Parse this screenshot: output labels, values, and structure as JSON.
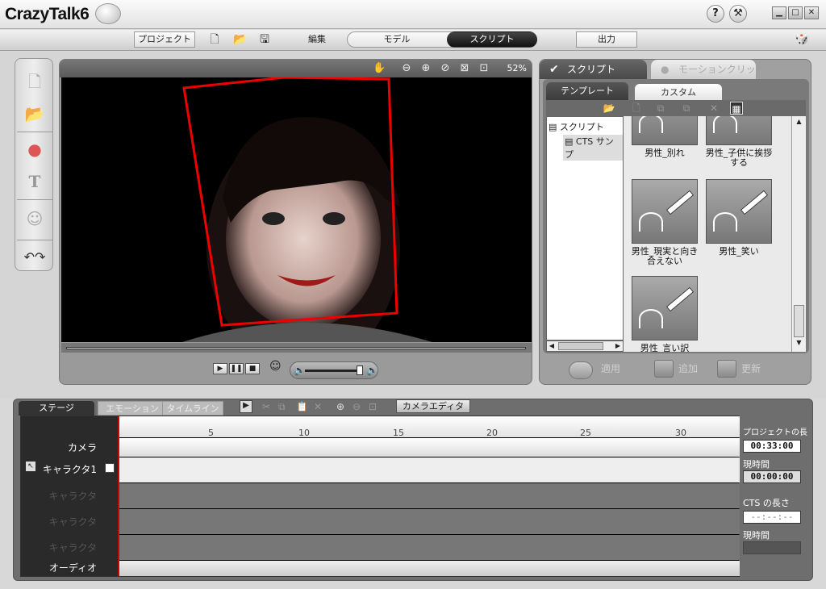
{
  "app": {
    "title": "CrazyTalk6"
  },
  "menu": {
    "project": "プロジェクト",
    "edit": "編集",
    "model": "モデル",
    "script": "スクリプト",
    "output": "出力"
  },
  "viewer": {
    "zoom": "52%"
  },
  "right_panel": {
    "tab_script": "スクリプト",
    "tab_motion": "モーションクリップ",
    "subtab_template": "テンプレート",
    "subtab_custom": "カスタム",
    "tree": {
      "root": "スクリプト",
      "child": "CTS サンプ"
    },
    "thumbnails": [
      {
        "label": "男性_別れ"
      },
      {
        "label": "男性_子供に挨拶する"
      },
      {
        "label": "男性_現実と向き合えない"
      },
      {
        "label": "男性_笑い"
      },
      {
        "label": "男性_言い訳"
      }
    ],
    "apply": "適用",
    "add": "追加",
    "update": "更新"
  },
  "timeline": {
    "tab_stage": "ステージ",
    "tab_emotion": "エモーション",
    "tab_timeline": "タイムライン",
    "camera_editor": "カメラエディタ",
    "ticks": [
      "5",
      "10",
      "15",
      "20",
      "25",
      "30"
    ],
    "rows": [
      {
        "name": "カメラ",
        "dim": false
      },
      {
        "name": "キャラクタ1",
        "dim": false
      },
      {
        "name": "キャラクタ",
        "dim": true
      },
      {
        "name": "キャラクタ",
        "dim": true
      },
      {
        "name": "キャラクタ",
        "dim": true
      },
      {
        "name": "オーディオ",
        "dim": false
      }
    ],
    "project_length_label": "プロジェクトの長さ",
    "project_length": "00:33:00",
    "current_time_label": "現時間",
    "current_time": "00:00:00",
    "cts_length_label": "CTS の長さ",
    "cts_length": "--:--:--",
    "current_time_label2": "現時間"
  }
}
